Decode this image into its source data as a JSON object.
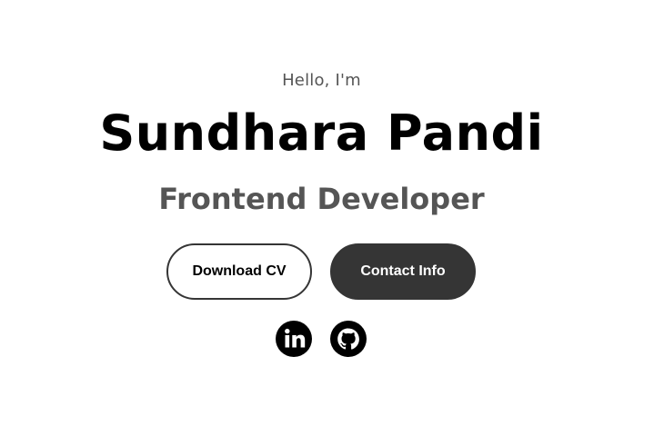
{
  "hero": {
    "greeting": "Hello, I'm",
    "name": "Sundhara Pandi",
    "role": "Frontend Developer"
  },
  "buttons": {
    "download_cv": "Download CV",
    "contact_info": "Contact Info"
  },
  "socials": [
    {
      "icon": "linkedin-icon"
    },
    {
      "icon": "github-icon"
    }
  ],
  "colors": {
    "background": "#ffffff",
    "text_primary": "#000000",
    "text_secondary": "#555555",
    "button_dark": "#353535"
  }
}
